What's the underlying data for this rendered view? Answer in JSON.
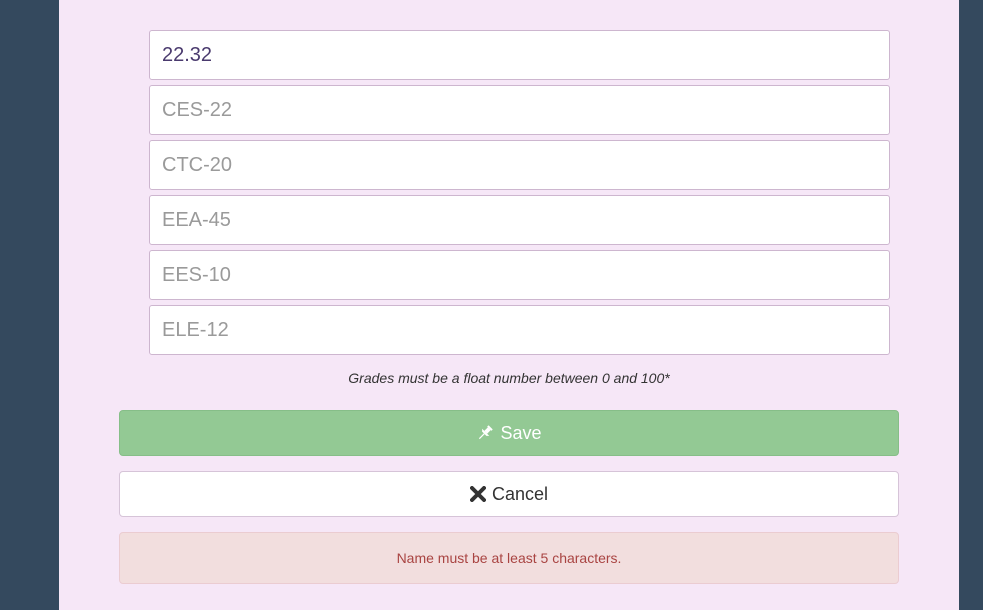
{
  "form": {
    "fields": [
      {
        "value": "22.32",
        "placeholder": ""
      },
      {
        "value": "",
        "placeholder": "CES-22"
      },
      {
        "value": "",
        "placeholder": "CTC-20"
      },
      {
        "value": "",
        "placeholder": "EEA-45"
      },
      {
        "value": "",
        "placeholder": "EES-10"
      },
      {
        "value": "",
        "placeholder": "ELE-12"
      }
    ],
    "hint": "Grades must be a float number between 0 and 100*"
  },
  "buttons": {
    "save_label": "Save",
    "save_icon": "pushpin-icon",
    "cancel_label": "Cancel",
    "cancel_icon": "close-icon"
  },
  "alert": {
    "message": "Name must be at least 5 characters."
  },
  "colors": {
    "background": "#34495e",
    "panel": "#f6e7f7",
    "save_button": "#93c994",
    "alert_background": "#f2dede",
    "alert_text": "#a94442"
  }
}
